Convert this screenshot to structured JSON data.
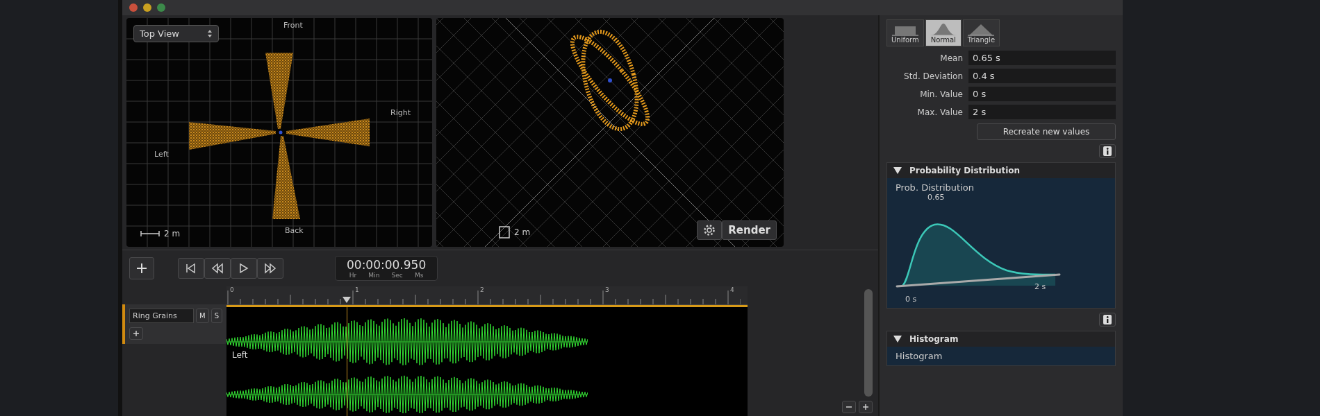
{
  "top_view": {
    "view_menu": "Top View",
    "axis_labels": {
      "front": "Front",
      "right": "Right",
      "left": "Left",
      "back": "Back"
    },
    "scale": "2 m"
  },
  "perspective_view": {
    "scale": "2 m"
  },
  "render_button": "Render",
  "transport": {
    "time": "00:00:00.950",
    "units": [
      "Hr",
      "Min",
      "Sec",
      "Ms"
    ]
  },
  "ruler": [
    "0",
    "1",
    "2",
    "3",
    "4"
  ],
  "track": {
    "name": "Ring Grains",
    "mute": "M",
    "solo": "S",
    "channel": "Left"
  },
  "inspector": {
    "distributions": [
      {
        "label": "Uniform",
        "kind": "uniform",
        "selected": false
      },
      {
        "label": "Normal",
        "kind": "normal",
        "selected": true
      },
      {
        "label": "Triangle",
        "kind": "triangle",
        "selected": false
      }
    ],
    "fields": [
      {
        "label": "Mean",
        "value": "0.65 s"
      },
      {
        "label": "Std. Deviation",
        "value": "0.4 s"
      },
      {
        "label": "Min. Value",
        "value": "0 s"
      },
      {
        "label": "Max. Value",
        "value": "2 s"
      }
    ],
    "recreate_button": "Recreate new values",
    "sections": [
      {
        "kind": "distribution",
        "title": "Probability Distribution",
        "expanded": true,
        "chart_title": "Prob. Distribution",
        "peak_label": "0.65",
        "axis_min": "0 s",
        "axis_max": "2 s"
      },
      {
        "kind": "histogram",
        "title": "Histogram",
        "expanded": true,
        "chart_title": "Histogram"
      }
    ]
  }
}
